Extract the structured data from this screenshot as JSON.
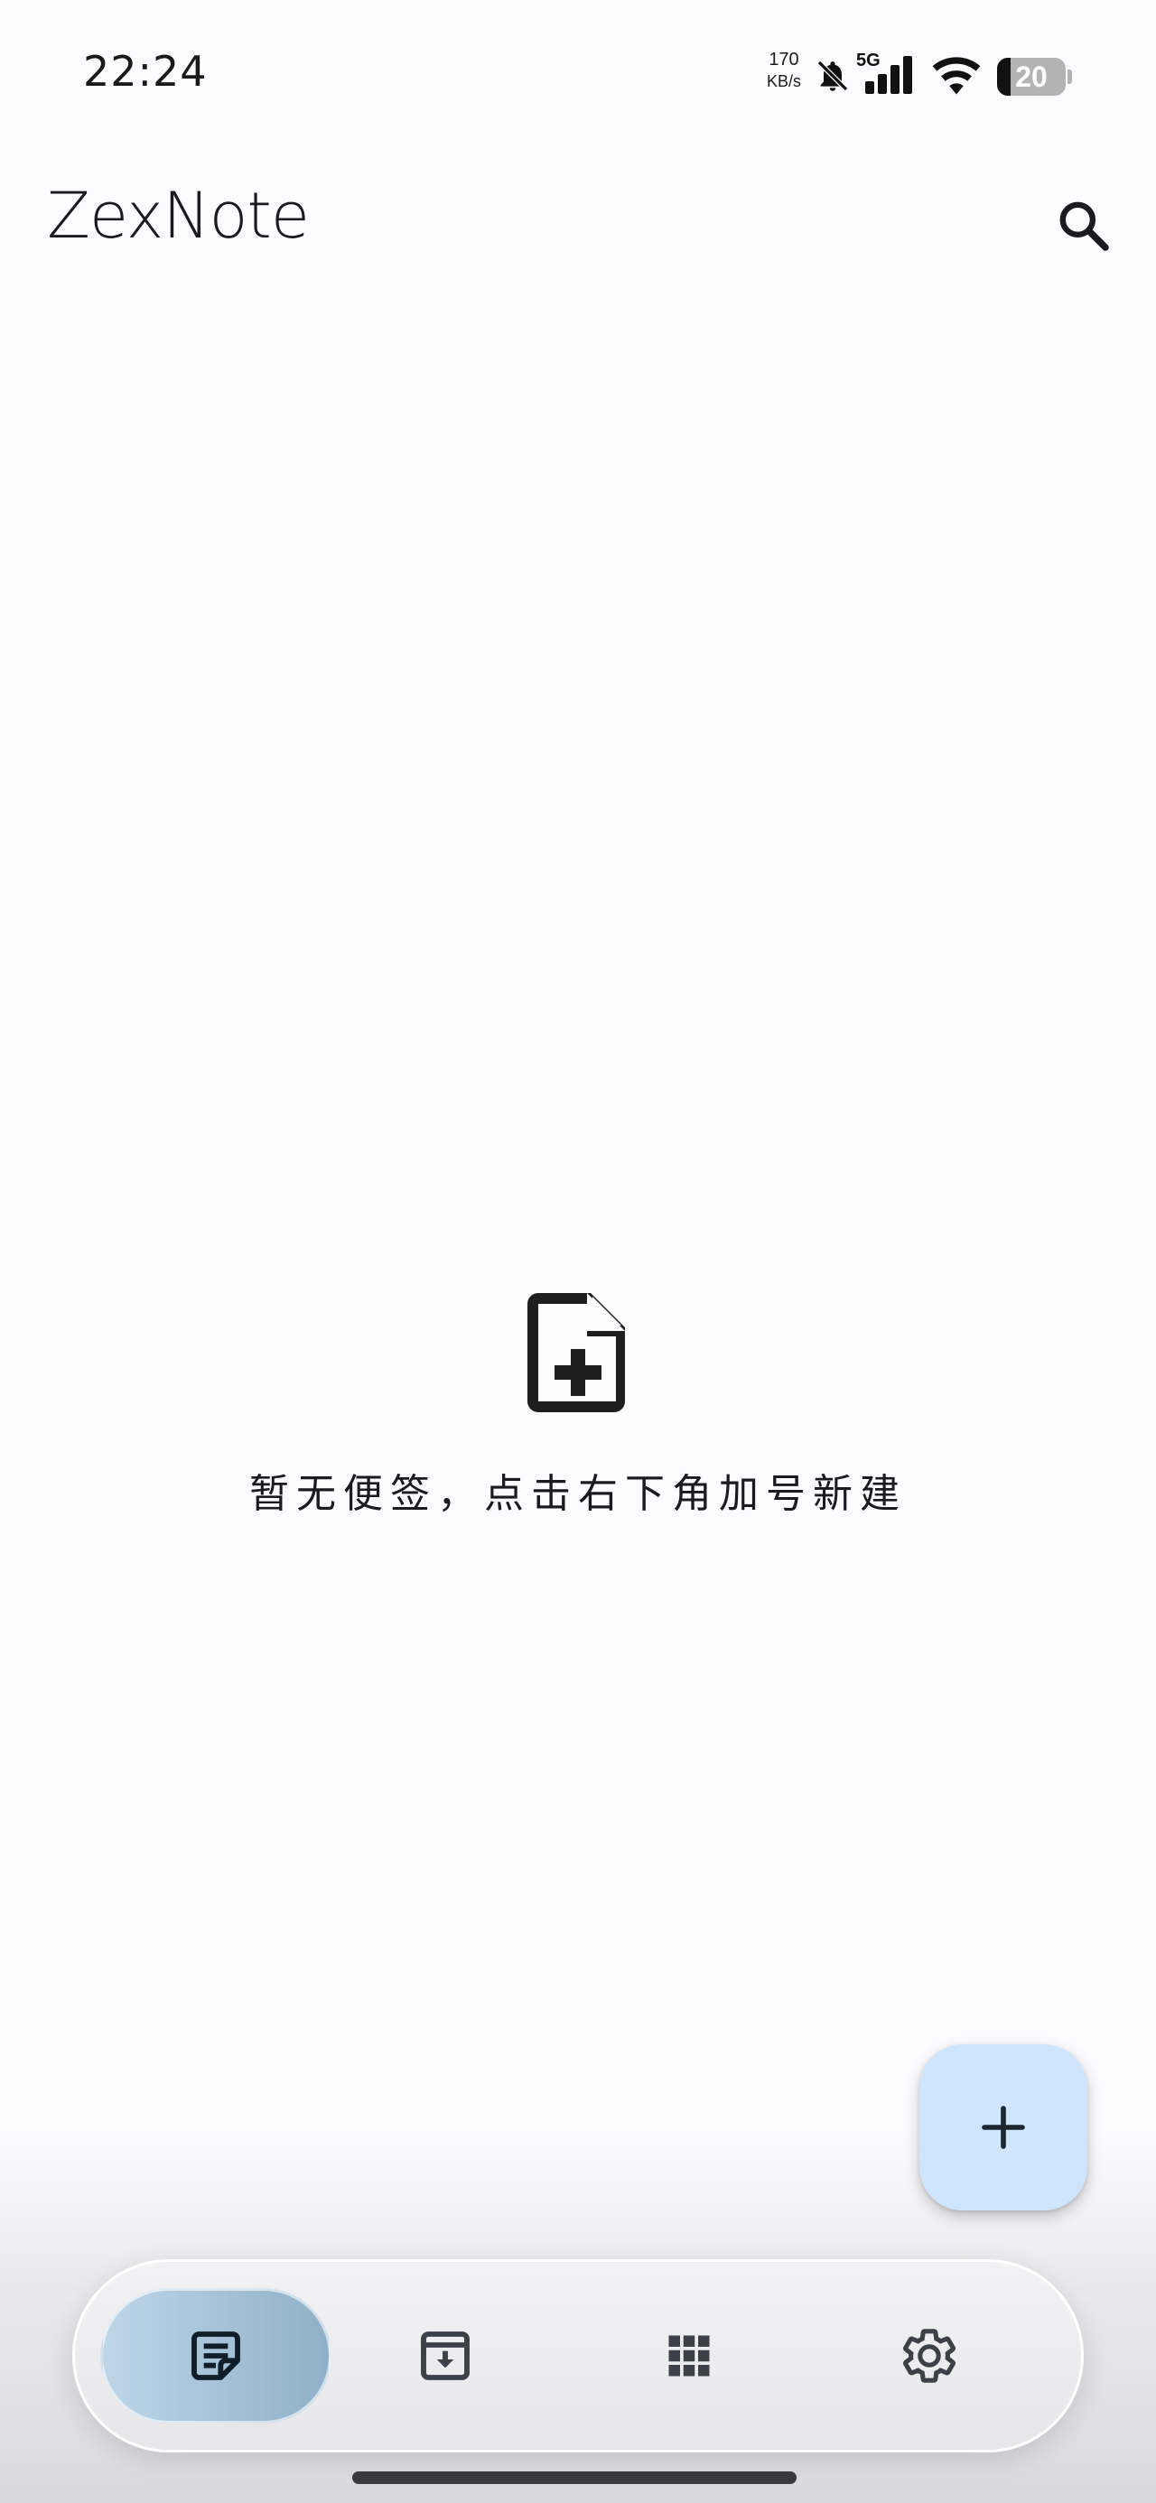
{
  "status_bar": {
    "time": "22:24",
    "net_speed_value": "170",
    "net_speed_unit": "KB/s",
    "network_type": "5G",
    "battery_level": "20",
    "battery_fraction": 0.2,
    "icons": [
      "bell-muted-icon",
      "signal-5g-icon",
      "wifi-icon",
      "battery-icon"
    ]
  },
  "app_bar": {
    "title": "ZexNote",
    "search_icon": "search-icon"
  },
  "empty_state": {
    "icon": "note-add-icon",
    "message": "暂无便签，点击右下角加号新建"
  },
  "fab": {
    "icon": "plus-icon",
    "color": "#cfe5fb"
  },
  "bottom_nav": {
    "items": [
      {
        "name": "notes",
        "icon": "sticky-note-icon",
        "active": true
      },
      {
        "name": "archive",
        "icon": "archive-icon",
        "active": false
      },
      {
        "name": "apps",
        "icon": "apps-grid-icon",
        "active": false
      },
      {
        "name": "settings",
        "icon": "gear-icon",
        "active": false
      }
    ],
    "active_color": "#a9c4d8"
  }
}
